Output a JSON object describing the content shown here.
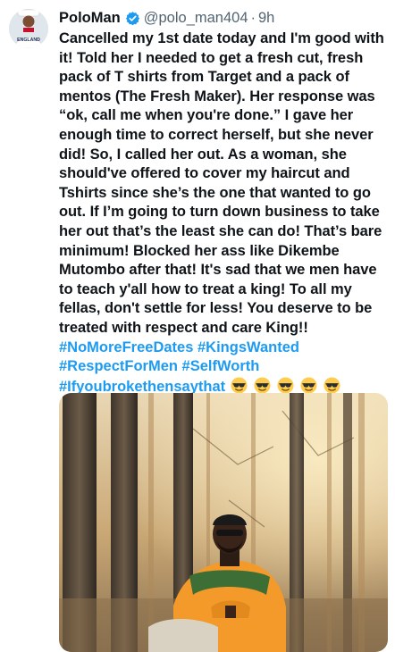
{
  "tweet": {
    "display_name": "PoloMan",
    "handle": "@polo_man404",
    "separator": "·",
    "time": "9h",
    "avatar_text": "ENGLAND",
    "text": "Cancelled my 1st date today and I'm good with it! Told her I needed to get a fresh cut, fresh pack of T shirts from Target and a pack of mentos (The Fresh Maker). Her response was “ok, call me when you're done.” I gave her enough time to correct herself, but she never did! So, I called her out. As a woman, she should've offered to cover my haircut and Tshirts since she’s the one that wanted to go out. If I’m going to turn down business to take her out that’s the least she can do! That’s bare minimum! Blocked her ass like Dikembe Mutombo after that! It's sad that we men have to teach y'all how to treat a king! To all my fellas, don't settle for less! You deserve to be treated with respect and care King!!",
    "hashtags": [
      "#NoMoreFreeDates",
      "#KingsWanted",
      "#RespectForMen",
      "#SelfWorth",
      "#Ifyoubrokethensaythat"
    ],
    "emoji": [
      "sunglasses-emoji",
      "sunglasses-emoji",
      "sunglasses-emoji",
      "sunglasses-emoji",
      "sunglasses-emoji"
    ]
  },
  "colors": {
    "link": "#1d9bf0",
    "verified": "#1d9bf0",
    "secondary_text": "#536471",
    "hoodie": "#f39a2a"
  }
}
